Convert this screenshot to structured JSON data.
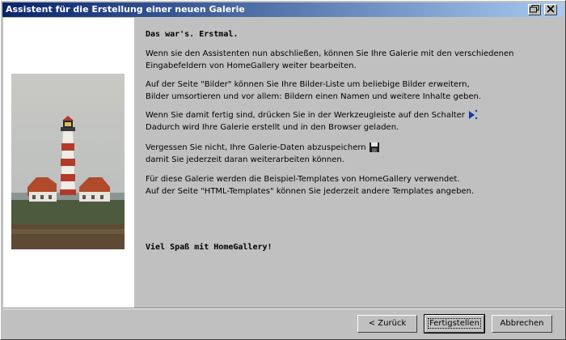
{
  "window": {
    "title": "Assistent für die Erstellung einer neuen Galerie"
  },
  "content": {
    "heading": "Das war's. Erstmal.",
    "p1_line1": "Wenn sie den Assistenten nun abschließen, können Sie Ihre Galerie mit den verschiedenen",
    "p1_line2": "Eingabefeldern von HomeGallery weiter bearbeiten.",
    "p2_line1": "Auf der Seite \"Bilder\" können Sie Ihre Bilder-Liste um beliebige Bilder erweitern,",
    "p2_line2": "Bilder umsortieren und vor allem: Bildern einen Namen und weitere Inhalte geben.",
    "p3_line1": "Wenn Sie damit fertig sind, drücken Sie in der Werkzeugleiste auf den Schalter",
    "p3_line2": "Dadurch wird Ihre Galerie erstellt und in den Browser geladen.",
    "p4_line1": "Vergessen Sie nicht, Ihre Galerie-Daten abzuspeichern",
    "p4_line2": "damit Sie jederzeit daran weiterarbeiten können.",
    "p5_line1": "Für diese Galerie werden die Beispiel-Templates von HomeGallery verwendet.",
    "p5_line2": "Auf der Seite \"HTML-Templates\" können Sie jederzeit andere Templates angeben.",
    "closing": "Viel Spaß mit HomeGallery!"
  },
  "buttons": {
    "back": "< Zurück",
    "finish": "Fertigstellen",
    "cancel": "Abbrechen"
  },
  "icons": {
    "run": "build-run-icon",
    "save": "floppy-disk-icon"
  }
}
